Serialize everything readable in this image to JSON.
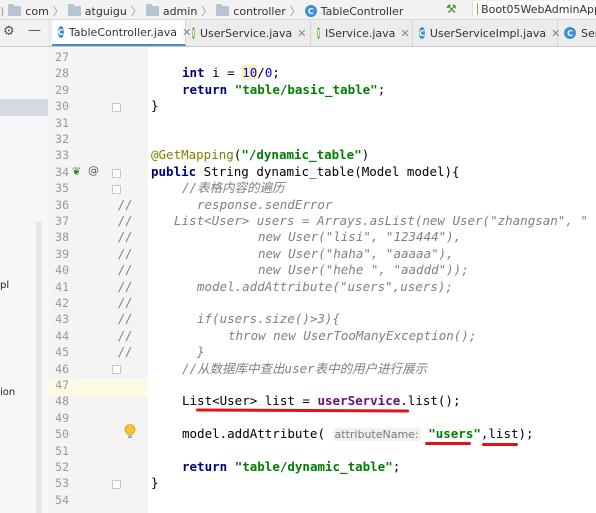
{
  "breadcrumb": {
    "items": [
      "com",
      "atguigu",
      "admin",
      "controller",
      "TableController"
    ]
  },
  "run_config": {
    "label": "Boot05WebAdminApp"
  },
  "tabs": [
    {
      "label": "TableController.java",
      "icon": "class-icon",
      "active": true
    },
    {
      "label": "UserService.java",
      "icon": "interface-icon",
      "active": false
    },
    {
      "label": "IService.java",
      "icon": "interface-icon",
      "active": false
    },
    {
      "label": "UserServiceImpl.java",
      "icon": "class-icon",
      "active": false
    },
    {
      "label": "Ser",
      "icon": "class-icon",
      "active": false
    }
  ],
  "left_panel": {
    "texts": [
      "pl",
      "ion"
    ]
  },
  "editor": {
    "current_line": 50,
    "line_numbers": [
      "27",
      "28",
      "29",
      "30",
      "31",
      "32",
      "33",
      "34",
      "35",
      "36",
      "37",
      "38",
      "39",
      "40",
      "41",
      "42",
      "43",
      "44",
      "45",
      "46",
      "47",
      "48",
      "49",
      "50",
      "51",
      "52",
      "53",
      "54"
    ],
    "code": {
      "l28_kw": "int",
      "l28_a": " i = ",
      "l28_n1": "10",
      "l28_b": "/",
      "l28_n2": "0",
      "l28_c": ";",
      "l29_kw": "return",
      "l29_str": "\"table/basic_table\"",
      "l29_end": ";",
      "l30": "}",
      "l33_ann": "@GetMapping",
      "l33_a": "(",
      "l33_str": "\"/dynamic_table\"",
      "l33_b": ")",
      "l34_kw": "public",
      "l34_rest": " String dynamic_table(Model model){",
      "l35": "//表格内容的遍历",
      "l36": "response.sendError",
      "l37": "List<User> users = Arrays.asList(new User(\"zhangsan\", \"",
      "l38": "new User(\"lisi\", \"123444\"),",
      "l39": "new User(\"haha\", \"aaaaa\"),",
      "l40": "new User(\"hehe \", \"aaddd\"));",
      "l41": "model.addAttribute(\"users\",users);",
      "l43": "if(users.size()>3){",
      "l44": "throw new UserTooManyException();",
      "l45": "}",
      "l46": "//从数据库中查出user表中的用户进行展示",
      "l48_a": "List<User> list = ",
      "l48_field": "userService",
      "l48_b": ".list();",
      "l50_a": "model.addAttribute( ",
      "l50_hint": "attributeName:",
      "l50_str": "\"users\"",
      "l50_b": ",list);",
      "l52_kw": "return",
      "l52_str": "\"table/dynamic_table\"",
      "l52_end": ";",
      "l53": "}"
    },
    "comment_marker": "//"
  },
  "colors": {
    "keyword": "#000080",
    "string": "#008000",
    "annotation": "#808000",
    "comment": "#808080",
    "field": "#660e7a",
    "red_underline": "#e0131a",
    "current_line_bg": "#fffae3"
  }
}
